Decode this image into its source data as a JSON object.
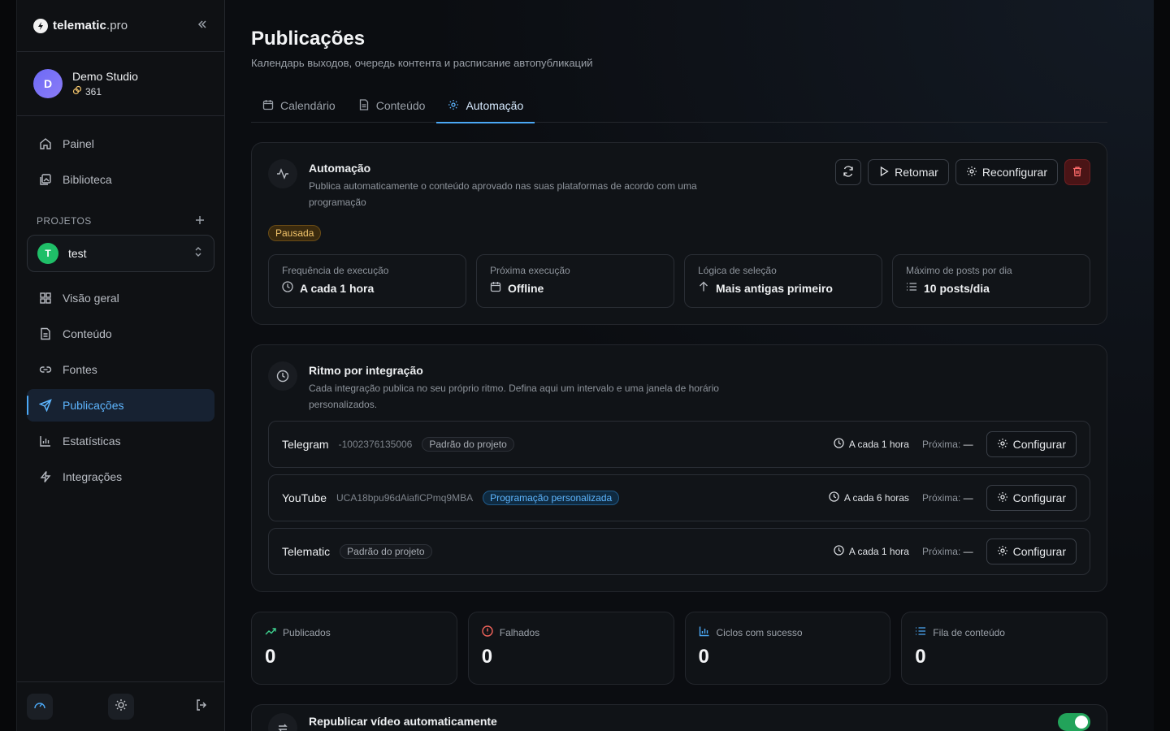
{
  "brand": {
    "name": "telematic",
    "suffix": ".pro"
  },
  "account": {
    "initial": "D",
    "name": "Demo Studio",
    "credits": "361"
  },
  "nav_top": [
    {
      "label": "Painel",
      "icon": "home-icon"
    },
    {
      "label": "Biblioteca",
      "icon": "image-icon"
    }
  ],
  "projects": {
    "label": "PROJETOS",
    "current_initial": "T",
    "current_name": "test"
  },
  "nav_project": [
    {
      "label": "Visão geral",
      "icon": "grid-icon"
    },
    {
      "label": "Conteúdo",
      "icon": "document-icon"
    },
    {
      "label": "Fontes",
      "icon": "link-icon"
    },
    {
      "label": "Publicações",
      "icon": "send-icon",
      "active": true
    },
    {
      "label": "Estatísticas",
      "icon": "bar-chart-icon"
    },
    {
      "label": "Integrações",
      "icon": "bolt-icon"
    }
  ],
  "page": {
    "title": "Publicações",
    "subtitle": "Календарь выходов, очередь контента и расписание автопубликаций"
  },
  "tabs": [
    {
      "label": "Calendário",
      "icon": "calendar-icon"
    },
    {
      "label": "Conteúdo",
      "icon": "document-icon"
    },
    {
      "label": "Automação",
      "icon": "gear-icon",
      "active": true
    }
  ],
  "automation": {
    "title": "Automação",
    "description": "Publica automaticamente o conteúdo aprovado nas suas plataformas de acordo com uma programação",
    "status": "Pausada",
    "resume_label": "Retomar",
    "reconfigure_label": "Reconfigurar",
    "stats": [
      {
        "label": "Frequência de execução",
        "value": "A cada 1 hora",
        "icon": "clock-icon"
      },
      {
        "label": "Próxima execução",
        "value": "Offline",
        "icon": "calendar-icon"
      },
      {
        "label": "Lógica de seleção",
        "value": "Mais antigas primeiro",
        "icon": "arrow-up-icon"
      },
      {
        "label": "Máximo de posts por dia",
        "value": "10 posts/dia",
        "icon": "list-icon"
      }
    ]
  },
  "rhythm": {
    "title": "Ritmo por integração",
    "description": "Cada integração publica no seu próprio ritmo. Defina aqui um intervalo e uma janela de horário personalizados.",
    "configure_label": "Configurar",
    "next_label": "Próxima:",
    "next_value": "—",
    "rows": [
      {
        "name": "Telegram",
        "id": "-1002376135006",
        "pill": "Padrão do projeto",
        "custom": false,
        "frequency": "A cada 1 hora"
      },
      {
        "name": "YouTube",
        "id": "UCA18bpu96dAiafiCPmq9MBA",
        "pill": "Programação personalizada",
        "custom": true,
        "frequency": "A cada 6 horas"
      },
      {
        "name": "Telematic",
        "id": "",
        "pill": "Padrão do projeto",
        "custom": false,
        "frequency": "A cada 1 hora"
      }
    ]
  },
  "metrics": [
    {
      "label": "Publicados",
      "value": "0",
      "icon": "trending-up-icon",
      "color": "#3ecf8e"
    },
    {
      "label": "Falhados",
      "value": "0",
      "icon": "alert-circle-icon",
      "color": "#f0635b"
    },
    {
      "label": "Ciclos com sucesso",
      "value": "0",
      "icon": "bar-chart-icon",
      "color": "#4ba8f5"
    },
    {
      "label": "Fila de conteúdo",
      "value": "0",
      "icon": "list-icon",
      "color": "#4ba8f5"
    }
  ],
  "republish": {
    "title": "Republicar vídeo automaticamente",
    "enabled": true
  }
}
